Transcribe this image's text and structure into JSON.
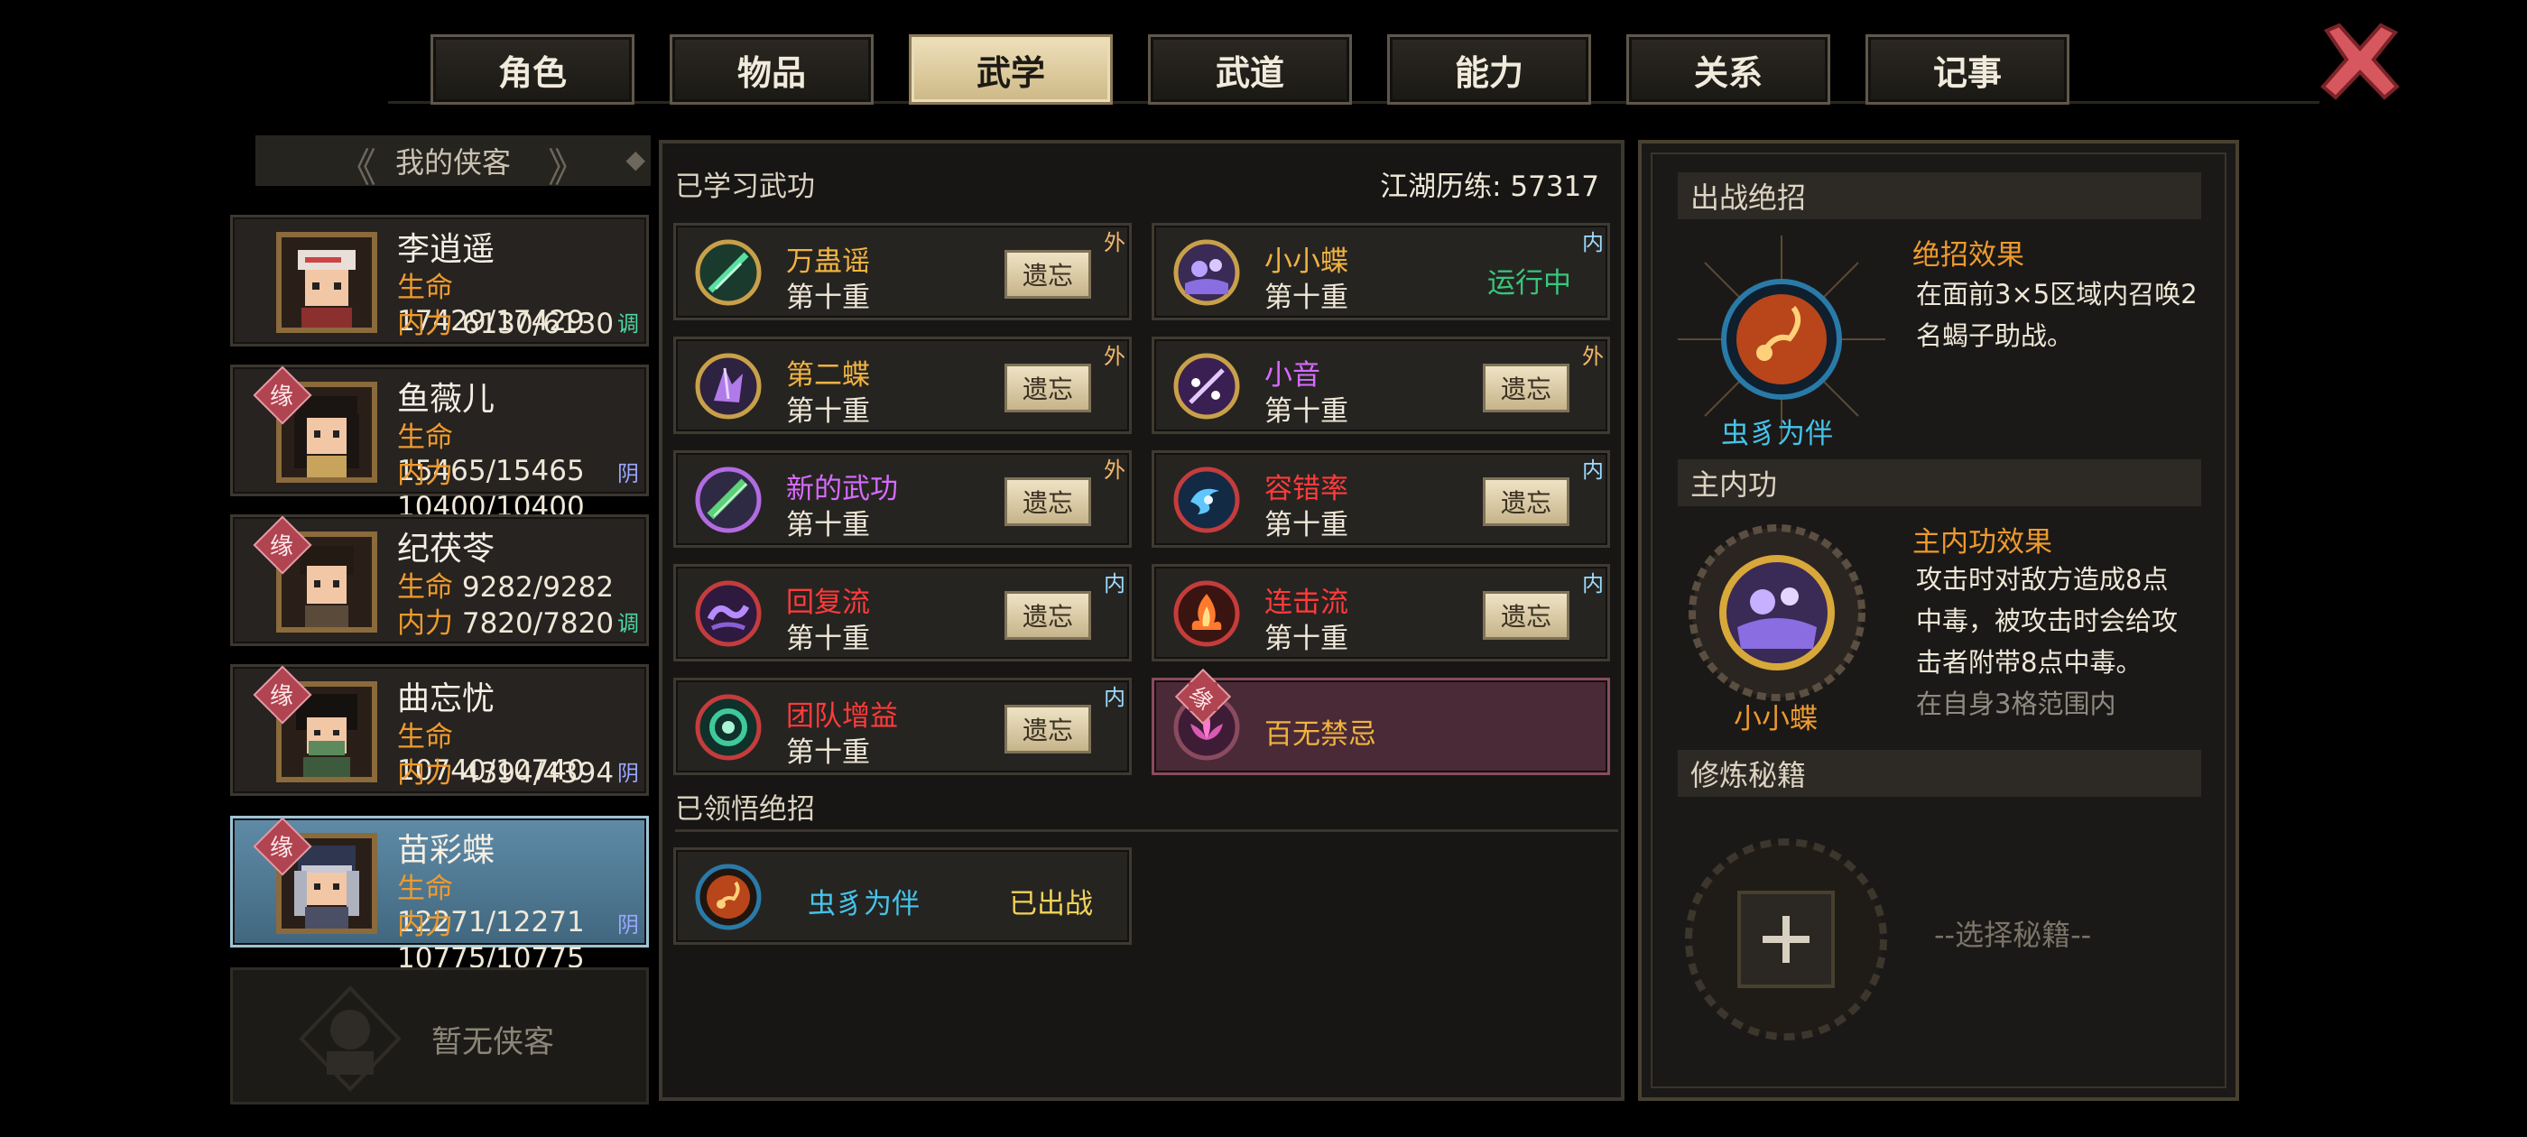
{
  "tabs": [
    {
      "label": "角色"
    },
    {
      "label": "物品"
    },
    {
      "label": "武学",
      "active": true
    },
    {
      "label": "武道"
    },
    {
      "label": "能力"
    },
    {
      "label": "关系"
    },
    {
      "label": "记事"
    }
  ],
  "left": {
    "header": "我的侠客",
    "characters": [
      {
        "name": "李逍遥",
        "hp_label": "生命",
        "hp": "17429/17429",
        "mp_label": "内力",
        "mp": "6130/6130",
        "tag": "调",
        "tag_color": "#4fd6a6",
        "yuan": false
      },
      {
        "name": "鱼薇儿",
        "hp_label": "生命",
        "hp": "15465/15465",
        "mp_label": "内力",
        "mp": "10400/10400",
        "tag": "阴",
        "tag_color": "#9aa7ff",
        "yuan": true,
        "yuan_label": "缘"
      },
      {
        "name": "纪茯苓",
        "hp_label": "生命",
        "hp": "9282/9282",
        "mp_label": "内力",
        "mp": "7820/7820",
        "tag": "调",
        "tag_color": "#4fd6a6",
        "yuan": true,
        "yuan_label": "缘"
      },
      {
        "name": "曲忘忧",
        "hp_label": "生命",
        "hp": "10740/10740",
        "mp_label": "内力",
        "mp": "4394/4394",
        "tag": "阴",
        "tag_color": "#9aa7ff",
        "yuan": true,
        "yuan_label": "缘"
      },
      {
        "name": "苗彩蝶",
        "hp_label": "生命",
        "hp": "12271/12271",
        "mp_label": "内力",
        "mp": "10775/10775",
        "tag": "阴",
        "tag_color": "#9aa7ff",
        "yuan": true,
        "yuan_label": "缘",
        "selected": true
      }
    ],
    "empty_slot": "暂无侠客"
  },
  "middle": {
    "learned_title": "已学习武功",
    "exp_label": "江湖历练: 57317",
    "forget_label": "遗忘",
    "running_label": "运行中",
    "level_label": "第十重",
    "skills": [
      {
        "name": "万蛊谣",
        "color": "#f0b341",
        "type": "外",
        "type_class": "wai",
        "has_level": true,
        "action": "forget",
        "icon": "green-slash-icon"
      },
      {
        "name": "小小蝶",
        "color": "#f0b341",
        "type": "内",
        "type_class": "nei",
        "has_level": true,
        "action": "running",
        "icon": "purple-bubble-icon"
      },
      {
        "name": "第二蝶",
        "color": "#f0b341",
        "type": "外",
        "type_class": "wai",
        "has_level": true,
        "action": "forget",
        "icon": "crystal-icon"
      },
      {
        "name": "小音",
        "color": "#d66bff",
        "type": "外",
        "type_class": "wai",
        "has_level": true,
        "action": "forget",
        "icon": "music-icon"
      },
      {
        "name": "新的武功",
        "color": "#d66bff",
        "type": "外",
        "type_class": "wai",
        "has_level": true,
        "action": "forget",
        "icon": "scroll-icon"
      },
      {
        "name": "容错率",
        "color": "#ff3b3b",
        "type": "内",
        "type_class": "nei",
        "has_level": true,
        "action": "forget",
        "icon": "swirl-icon"
      },
      {
        "name": "回复流",
        "color": "#ff3b3b",
        "type": "内",
        "type_class": "nei",
        "has_level": true,
        "action": "forget",
        "icon": "wave-icon"
      },
      {
        "name": "连击流",
        "color": "#ff3b3b",
        "type": "内",
        "type_class": "nei",
        "has_level": true,
        "action": "forget",
        "icon": "fire-icon"
      },
      {
        "name": "团队增益",
        "color": "#ff3b3b",
        "type": "内",
        "type_class": "nei",
        "has_level": true,
        "action": "forget",
        "icon": "ring-icon"
      },
      {
        "name": "百无禁忌",
        "color": "#f0b341",
        "type": "缘",
        "type_class": "yuan",
        "has_level": false,
        "action": "none",
        "icon": "lotus-icon",
        "special": true
      }
    ],
    "ultimate_title": "已领悟绝招",
    "ultimate": {
      "name": "虫豸为伴",
      "status": "已出战",
      "name_color": "#46c3ea"
    }
  },
  "right": {
    "battle_ultimate_head": "出战绝招",
    "ultimate_effect_title": "绝招效果",
    "ultimate_effect_text": "在面前3×5区域内召唤2名蝎子助战。",
    "ultimate_name": "虫豸为伴",
    "main_inner_head": "主内功",
    "inner_effect_title": "主内功效果",
    "inner_effect_text": "攻击时对敌方造成8点中毒，被攻击时会给攻击者附带8点中毒。",
    "inner_effect_cut": "在自身3格范围内",
    "inner_name": "小小蝶",
    "manual_head": "修炼秘籍",
    "manual_select": "--选择秘籍--"
  },
  "colors": {
    "accent_orange": "#ee9a2e",
    "running_green": "#39c67c",
    "ultimate_blue": "#46c3ea"
  }
}
